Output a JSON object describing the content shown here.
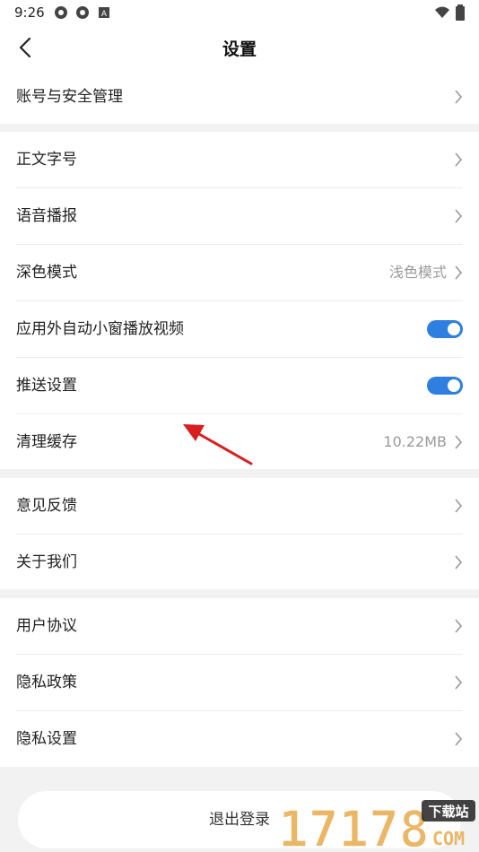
{
  "status_bar": {
    "time": "9:26",
    "icons": [
      "sync-icon",
      "sync-icon",
      "notification-a-icon"
    ],
    "right_icons": [
      "wifi-icon",
      "battery-icon"
    ]
  },
  "header": {
    "title": "设置",
    "back_icon": "back-arrow-icon"
  },
  "sections": [
    {
      "rows": [
        {
          "label": "账号与安全管理"
        }
      ]
    },
    {
      "rows": [
        {
          "label": "正文字号"
        },
        {
          "label": "语音播报"
        },
        {
          "label": "深色模式",
          "value": "浅色模式"
        },
        {
          "label": "应用外自动小窗播放视频",
          "toggle_on": true
        },
        {
          "label": "推送设置",
          "toggle_on": true
        },
        {
          "label": "清理缓存",
          "value": "10.22MB"
        }
      ]
    },
    {
      "rows": [
        {
          "label": "意见反馈"
        },
        {
          "label": "关于我们"
        }
      ]
    },
    {
      "rows": [
        {
          "label": "用户协议"
        },
        {
          "label": "隐私政策"
        },
        {
          "label": "隐私设置"
        }
      ]
    }
  ],
  "logout_button": {
    "label": "退出登录"
  },
  "watermark": {
    "text": "17178",
    "badge": "下载站",
    "suffix": "COM"
  },
  "colors": {
    "accent": "#2f7fe0",
    "annotation": "#d81f1f",
    "background": "#f2f2f2"
  }
}
